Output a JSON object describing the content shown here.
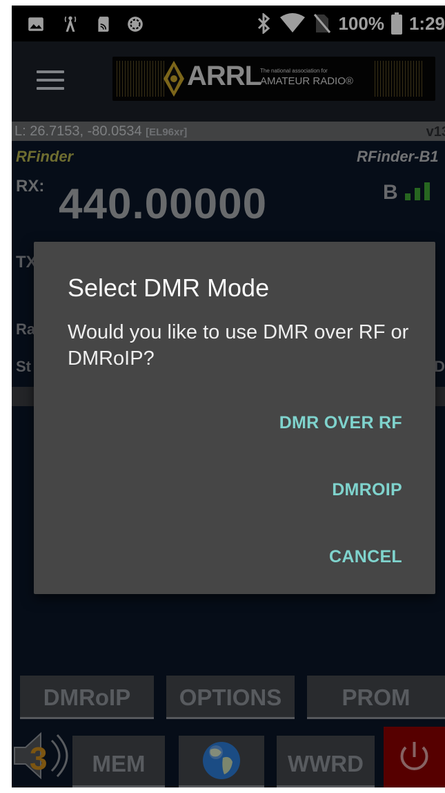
{
  "status_bar": {
    "battery": "100%",
    "time": "1:29"
  },
  "location": {
    "coords": "L: 26.7153, -80.0534",
    "grid": "[EL96xr]",
    "version": "v13"
  },
  "radio": {
    "left_name": "RFinder",
    "right_name": "RFinder-B1",
    "rx_label": "RX:",
    "rx_freq": "440.00000",
    "signal_letter": "B",
    "tx_partial": "TX",
    "ra_partial": "Ra",
    "st_partial": "St",
    "right_partial": "D"
  },
  "dialog": {
    "title": "Select DMR Mode",
    "message": "Would you like to use DMR over RF or DMRoIP?",
    "buttons": [
      "DMR OVER RF",
      "DMROIP",
      "CANCEL"
    ]
  },
  "bottom_row1": [
    "DMRoIP",
    "OPTIONS",
    "PROM"
  ],
  "bottom_row2": {
    "mem": "MEM",
    "wwrd": "WWRD",
    "speaker_badge": "3"
  },
  "colors": {
    "accent_teal": "#7fd3cd",
    "rfinder_yellow": "#b2b04e",
    "power_red": "#8b0000",
    "signal_green": "#3fa535"
  },
  "icons": [
    "image-icon",
    "tower-icon",
    "sd-card-icon",
    "sync-icon",
    "bluetooth-icon",
    "wifi-icon",
    "no-sim-icon",
    "battery-icon",
    "menu-icon",
    "globe-icon",
    "speaker-icon",
    "power-icon"
  ]
}
